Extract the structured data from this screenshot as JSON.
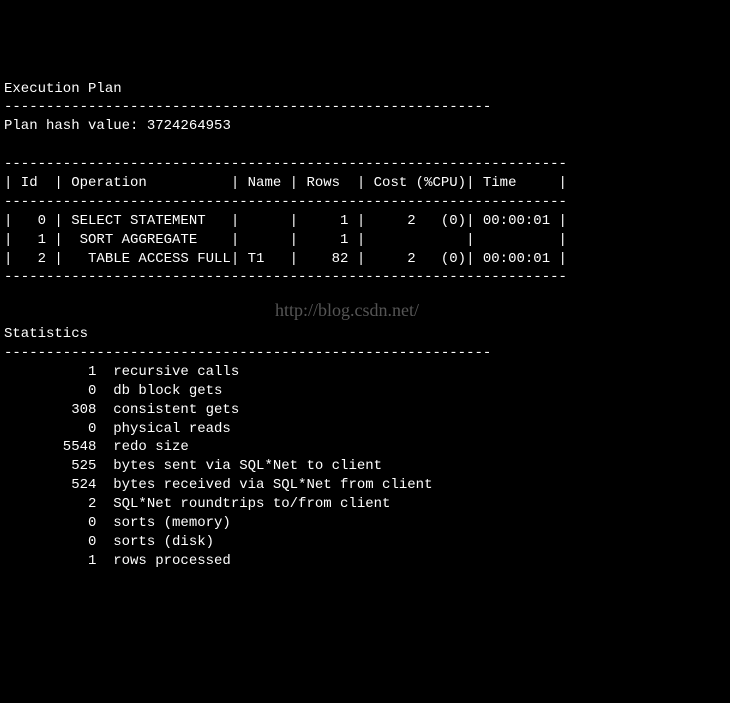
{
  "header": {
    "title": "Execution Plan",
    "divider": "----------------------------------------------------------",
    "plan_hash_label": "Plan hash value:",
    "plan_hash_value": "3724264953"
  },
  "table": {
    "border": "-------------------------------------------------------------------",
    "header_row": "| Id  | Operation          | Name | Rows  | Cost (%CPU)| Time     |",
    "rows": [
      "|   0 | SELECT STATEMENT   |      |     1 |     2   (0)| 00:00:01 |",
      "|   1 |  SORT AGGREGATE    |      |     1 |            |          |",
      "|   2 |   TABLE ACCESS FULL| T1   |    82 |     2   (0)| 00:00:01 |"
    ]
  },
  "chart_data": {
    "type": "table",
    "title": "Execution Plan",
    "plan_hash_value": 3724264953,
    "columns": [
      "Id",
      "Operation",
      "Name",
      "Rows",
      "Cost",
      "%CPU",
      "Time"
    ],
    "rows": [
      {
        "Id": 0,
        "Operation": "SELECT STATEMENT",
        "Name": "",
        "Rows": 1,
        "Cost": 2,
        "%CPU": 0,
        "Time": "00:00:01"
      },
      {
        "Id": 1,
        "Operation": "SORT AGGREGATE",
        "Name": "",
        "Rows": 1,
        "Cost": null,
        "%CPU": null,
        "Time": ""
      },
      {
        "Id": 2,
        "Operation": "TABLE ACCESS FULL",
        "Name": "T1",
        "Rows": 82,
        "Cost": 2,
        "%CPU": 0,
        "Time": "00:00:01"
      }
    ]
  },
  "stats": {
    "title": "Statistics",
    "divider": "----------------------------------------------------------",
    "items": [
      {
        "value": "1",
        "label": "recursive calls"
      },
      {
        "value": "0",
        "label": "db block gets"
      },
      {
        "value": "308",
        "label": "consistent gets"
      },
      {
        "value": "0",
        "label": "physical reads"
      },
      {
        "value": "5548",
        "label": "redo size"
      },
      {
        "value": "525",
        "label": "bytes sent via SQL*Net to client"
      },
      {
        "value": "524",
        "label": "bytes received via SQL*Net from client"
      },
      {
        "value": "2",
        "label": "SQL*Net roundtrips to/from client"
      },
      {
        "value": "0",
        "label": "sorts (memory)"
      },
      {
        "value": "0",
        "label": "sorts (disk)"
      },
      {
        "value": "1",
        "label": "rows processed"
      }
    ]
  },
  "watermark": "http://blog.csdn.net/"
}
